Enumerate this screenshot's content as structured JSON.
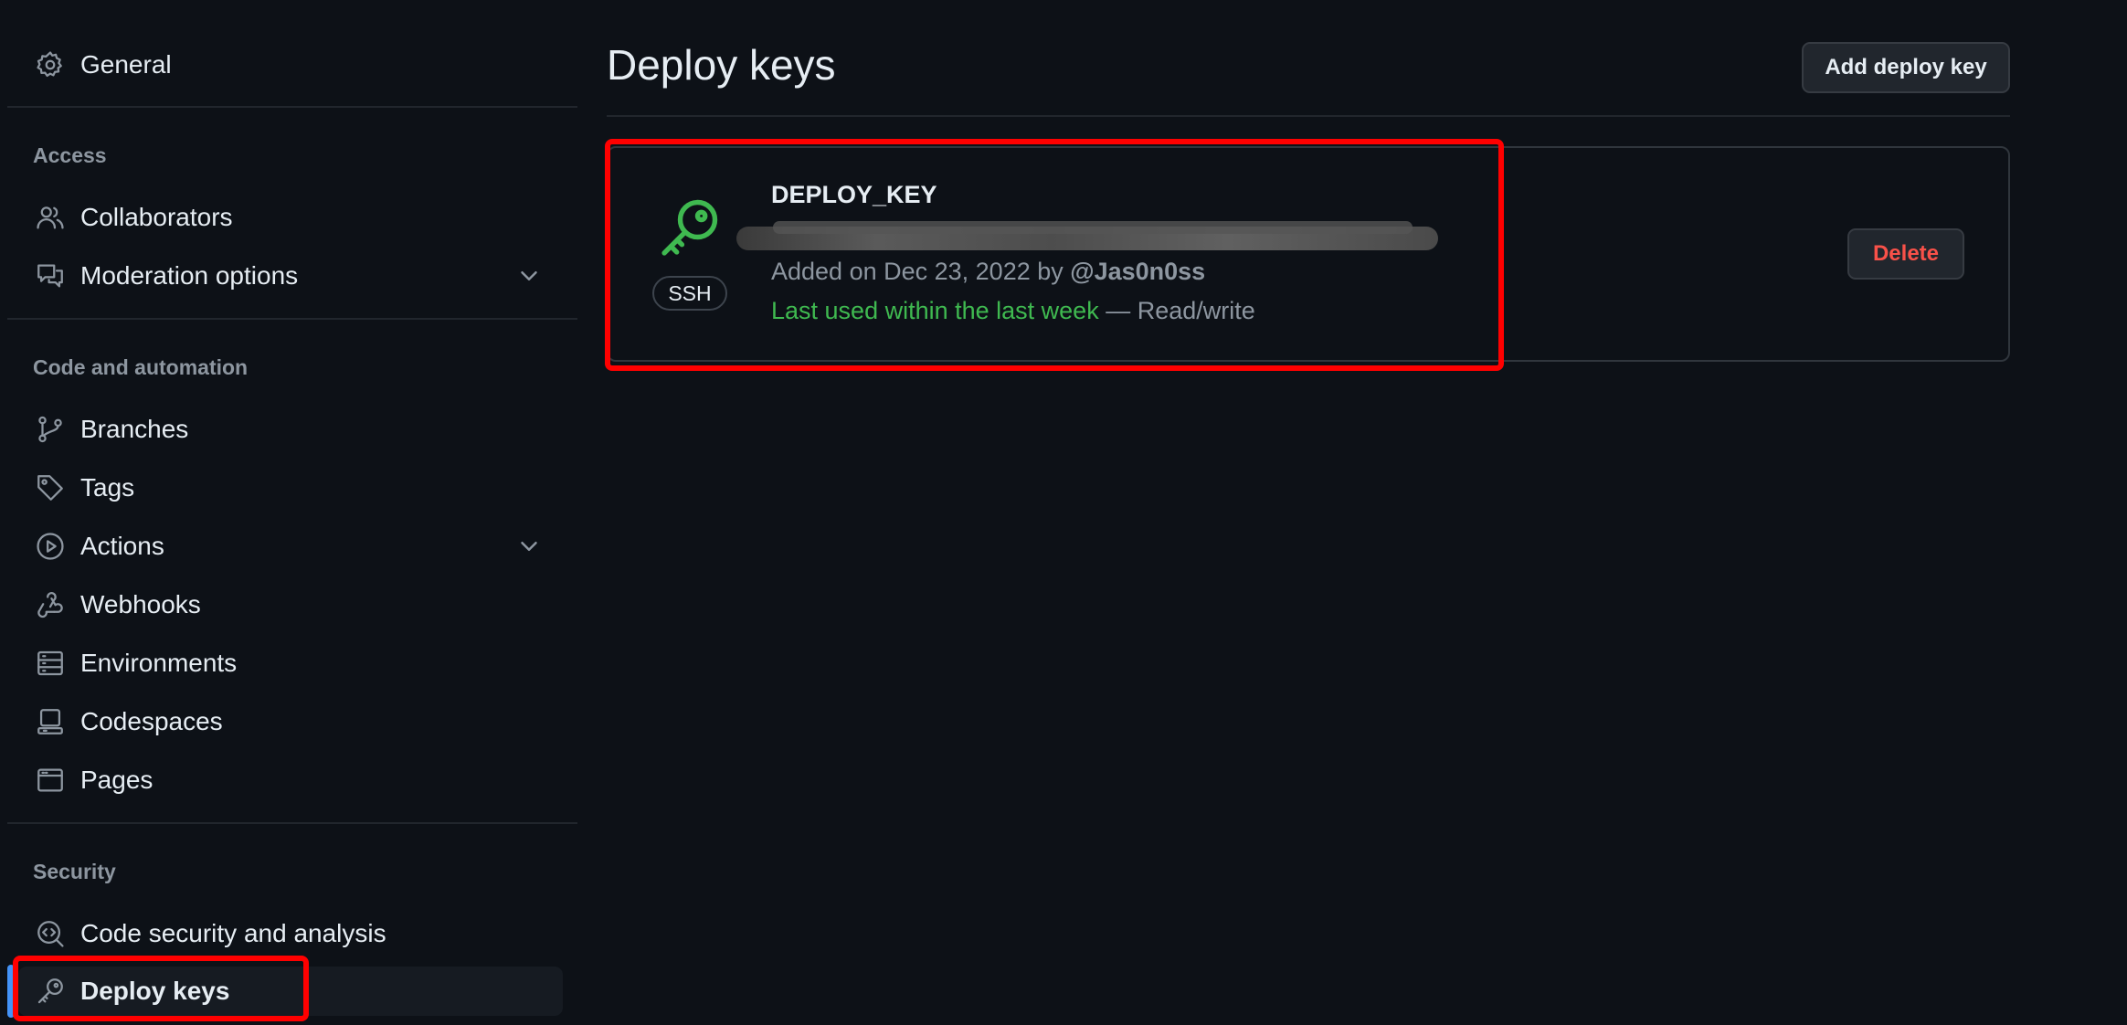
{
  "sidebar": {
    "general": {
      "label": "General",
      "icon": "gear-icon"
    },
    "sections": [
      {
        "heading": "Access"
      },
      {
        "heading": "Code and automation"
      },
      {
        "heading": "Security"
      }
    ],
    "items": [
      {
        "label": "Collaborators",
        "icon": "people-icon"
      },
      {
        "label": "Moderation options",
        "icon": "report-icon",
        "expandable": true
      },
      {
        "label": "Branches",
        "icon": "git-branch-icon"
      },
      {
        "label": "Tags",
        "icon": "tag-icon"
      },
      {
        "label": "Actions",
        "icon": "play-icon",
        "expandable": true
      },
      {
        "label": "Webhooks",
        "icon": "webhook-icon"
      },
      {
        "label": "Environments",
        "icon": "server-icon"
      },
      {
        "label": "Codespaces",
        "icon": "codespaces-icon"
      },
      {
        "label": "Pages",
        "icon": "browser-icon"
      },
      {
        "label": "Code security and analysis",
        "icon": "codescan-icon"
      },
      {
        "label": "Deploy keys",
        "icon": "key-icon",
        "active": true
      }
    ]
  },
  "main": {
    "title": "Deploy keys",
    "add_button": "Add deploy key",
    "key": {
      "type_badge": "SSH",
      "name": "DEPLOY_KEY",
      "added_prefix": "Added on Dec 23, 2022 by",
      "added_by": "@Jas0n0ss",
      "last_used": "Last used within the last week",
      "access": "— Read/write",
      "delete_button": "Delete"
    }
  },
  "colors": {
    "background": "#0d1117",
    "accent": "#4493f8",
    "success": "#3fb950",
    "danger": "#f85149",
    "highlight": "#ff0000"
  }
}
